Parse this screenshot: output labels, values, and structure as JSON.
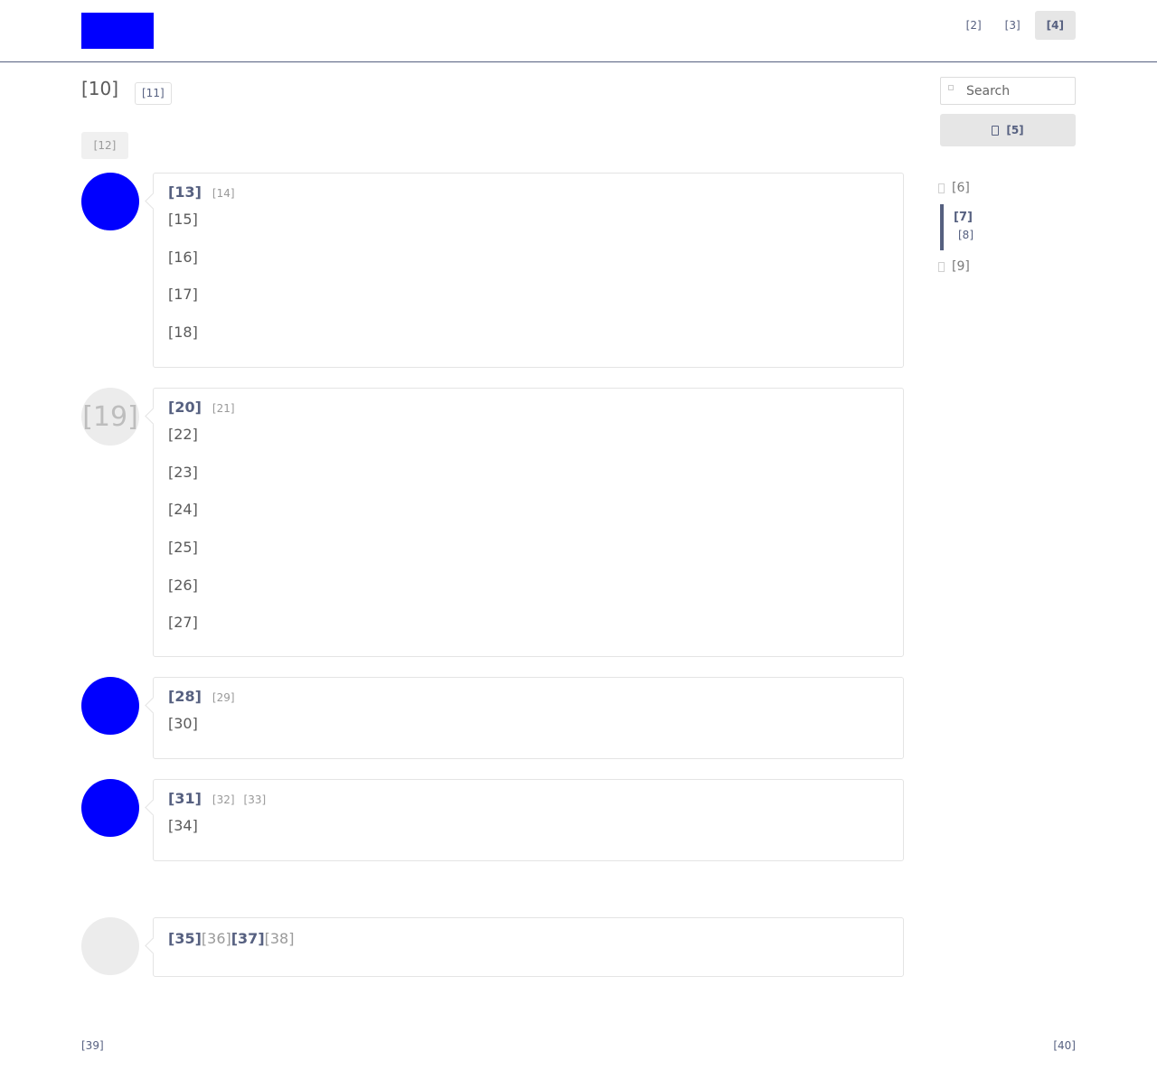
{
  "colors": {
    "logo": "#0000ff",
    "accent": "#566080",
    "avatar": "#0000ff"
  },
  "header": {
    "nav": [
      {
        "label": "[2]",
        "active": false
      },
      {
        "label": "[3]",
        "active": false
      },
      {
        "label": "[4]",
        "active": true
      }
    ]
  },
  "main": {
    "title": "[10]",
    "title_badge": "[11]",
    "filter_label": "[12]",
    "entries": [
      {
        "title": "[13]",
        "meta": [
          "[14]"
        ],
        "lines": [
          "[15]",
          "[16]",
          "[17]",
          "[18]"
        ]
      },
      {
        "avatar_text": "[19]",
        "title": "[20]",
        "meta": [
          "[21]"
        ],
        "lines": [
          "[22]",
          "[23]",
          "[24]",
          "[25]",
          "[26]",
          "[27]"
        ]
      },
      {
        "title": "[28]",
        "meta": [
          "[29]"
        ],
        "lines": [
          "[30]"
        ]
      },
      {
        "title": "[31]",
        "meta": [
          "[32]",
          "[33]"
        ],
        "lines": [
          "[34]"
        ]
      }
    ],
    "compose": {
      "parts": [
        "[35]",
        "[36]",
        "[37]",
        "[38]"
      ]
    }
  },
  "sidebar": {
    "search_placeholder": "Search",
    "button_label": "[5]",
    "nav": {
      "item1": "[6]",
      "group_title": "[7]",
      "group_sub": "[8]",
      "item2": "[9]"
    }
  },
  "footer": {
    "left": "[39]",
    "right": "[40]"
  }
}
